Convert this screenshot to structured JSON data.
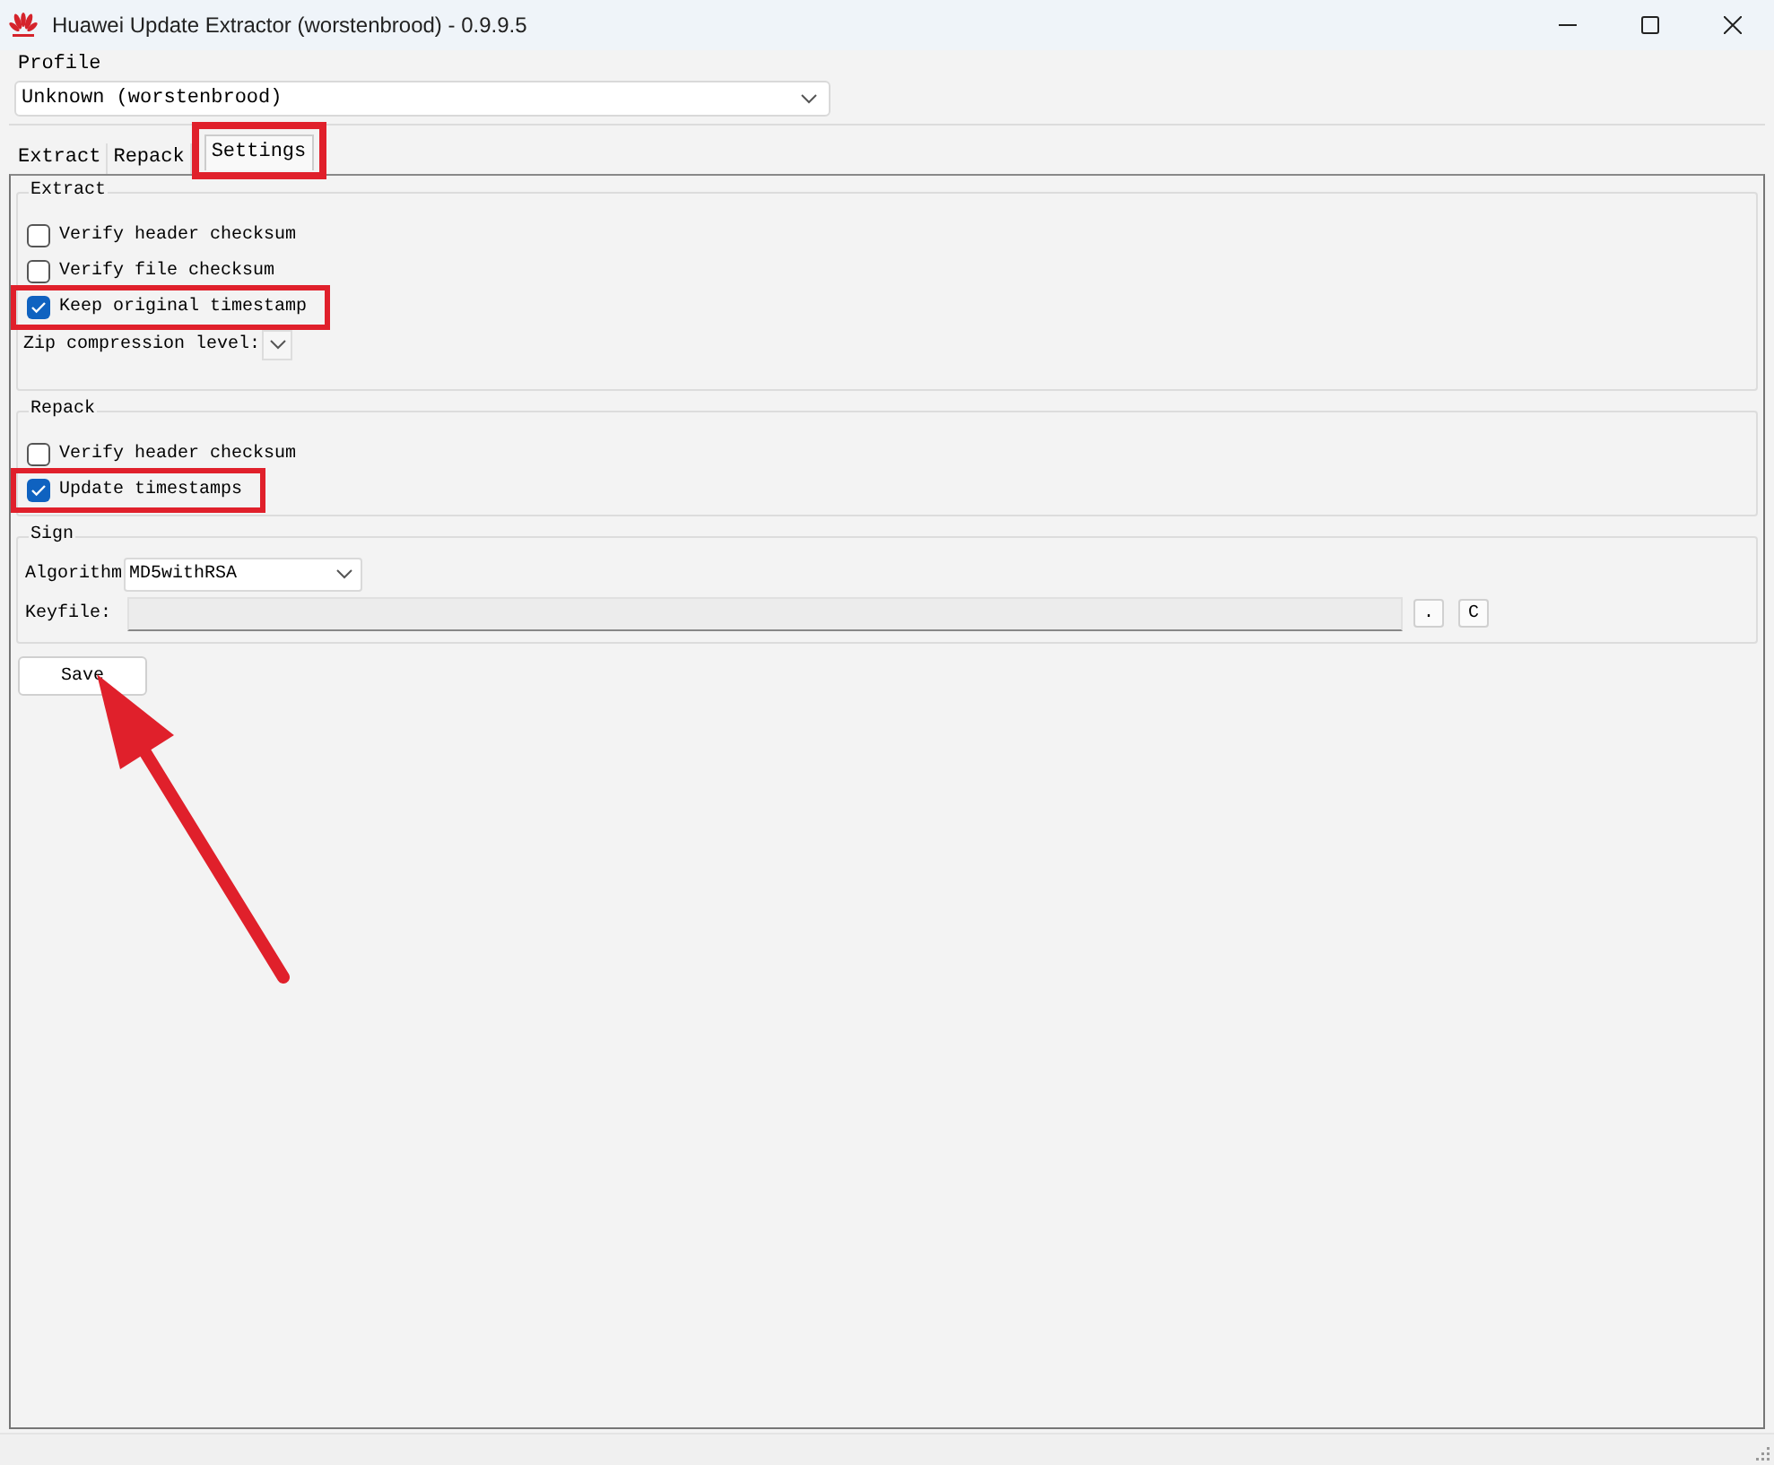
{
  "window": {
    "title": "Huawei Update Extractor (worstenbrood) - 0.9.9.5"
  },
  "profile": {
    "label": "Profile",
    "value": "Unknown (worstenbrood)"
  },
  "tabs": [
    {
      "label": "Extract",
      "selected": false,
      "highlighted": false
    },
    {
      "label": "Repack",
      "selected": false,
      "highlighted": false
    },
    {
      "label": "Settings",
      "selected": true,
      "highlighted": true
    }
  ],
  "extract": {
    "title": "Extract",
    "checkboxes": [
      {
        "label": "Verify header checksum",
        "checked": false,
        "highlighted": false
      },
      {
        "label": "Verify file checksum",
        "checked": false,
        "highlighted": false
      },
      {
        "label": "Keep original timestamp",
        "checked": true,
        "highlighted": true
      }
    ],
    "zip_label": "Zip compression level:"
  },
  "repack": {
    "title": "Repack",
    "checkboxes": [
      {
        "label": "Verify header checksum",
        "checked": false,
        "highlighted": false
      },
      {
        "label": "Update timestamps",
        "checked": true,
        "highlighted": true
      }
    ]
  },
  "sign": {
    "title": "Sign",
    "algorithm_label": "Algorithm",
    "algorithm_value": "MD5withRSA",
    "keyfile_label": "Keyfile:",
    "buttons": [
      ".",
      "C"
    ]
  },
  "save_button": "Save"
}
